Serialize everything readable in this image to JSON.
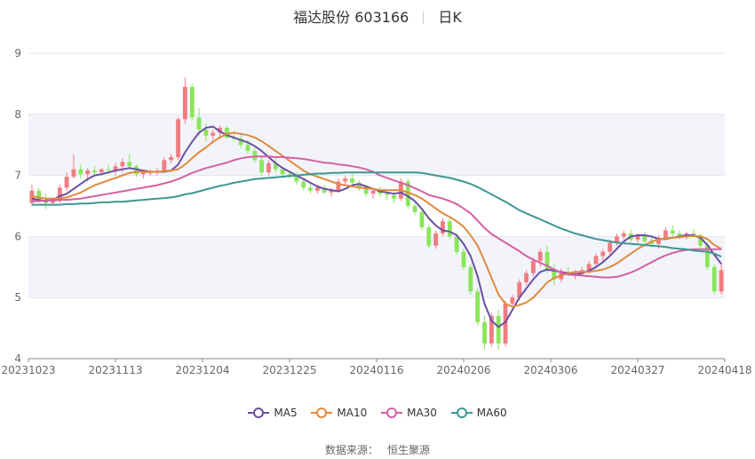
{
  "chart_data": {
    "type": "candlestick",
    "title": "福达股份 603166",
    "period": "日K",
    "ylim": [
      4,
      9
    ],
    "yticks": [
      4,
      5,
      6,
      7,
      8,
      9
    ],
    "x_tick_labels": [
      "20231023",
      "20231113",
      "20231204",
      "20231225",
      "20240116",
      "20240206",
      "20240306",
      "20240327",
      "20240418"
    ],
    "grid": true,
    "legend_position": "bottom",
    "colors": {
      "up": "#f07c82",
      "down": "#8ae65a",
      "MA5": "#6a4fa3",
      "MA10": "#e08a3c",
      "MA30": "#d65fa6",
      "MA60": "#3e9695"
    },
    "ohlc": [
      [
        6.55,
        6.85,
        6.5,
        6.75
      ],
      [
        6.75,
        6.8,
        6.55,
        6.6
      ],
      [
        6.6,
        6.7,
        6.45,
        6.55
      ],
      [
        6.55,
        6.6,
        6.5,
        6.58
      ],
      [
        6.58,
        6.85,
        6.55,
        6.8
      ],
      [
        6.8,
        7.05,
        6.75,
        6.98
      ],
      [
        6.98,
        7.35,
        6.95,
        7.1
      ],
      [
        7.1,
        7.18,
        6.95,
        7.02
      ],
      [
        7.02,
        7.12,
        6.9,
        7.08
      ],
      [
        7.08,
        7.15,
        7.0,
        7.05
      ],
      [
        7.05,
        7.12,
        7.0,
        7.1
      ],
      [
        7.1,
        7.18,
        7.02,
        7.08
      ],
      [
        7.08,
        7.2,
        7.0,
        7.15
      ],
      [
        7.15,
        7.28,
        7.05,
        7.22
      ],
      [
        7.22,
        7.35,
        7.1,
        7.15
      ],
      [
        7.15,
        7.18,
        6.98,
        7.02
      ],
      [
        7.02,
        7.08,
        6.95,
        7.05
      ],
      [
        7.05,
        7.1,
        7.0,
        7.05
      ],
      [
        7.05,
        7.12,
        7.0,
        7.08
      ],
      [
        7.08,
        7.3,
        7.05,
        7.25
      ],
      [
        7.25,
        7.35,
        7.2,
        7.3
      ],
      [
        7.3,
        7.95,
        7.25,
        7.92
      ],
      [
        7.92,
        8.6,
        7.85,
        8.45
      ],
      [
        8.45,
        8.5,
        7.9,
        7.95
      ],
      [
        7.95,
        8.1,
        7.65,
        7.75
      ],
      [
        7.75,
        7.85,
        7.55,
        7.65
      ],
      [
        7.65,
        7.75,
        7.55,
        7.7
      ],
      [
        7.7,
        7.82,
        7.6,
        7.78
      ],
      [
        7.78,
        7.8,
        7.6,
        7.62
      ],
      [
        7.62,
        7.7,
        7.55,
        7.6
      ],
      [
        7.6,
        7.68,
        7.45,
        7.5
      ],
      [
        7.5,
        7.58,
        7.35,
        7.4
      ],
      [
        7.4,
        7.45,
        7.2,
        7.25
      ],
      [
        7.25,
        7.3,
        7.0,
        7.05
      ],
      [
        7.05,
        7.25,
        7.0,
        7.2
      ],
      [
        7.2,
        7.28,
        7.05,
        7.1
      ],
      [
        7.1,
        7.15,
        7.0,
        7.02
      ],
      [
        7.02,
        7.08,
        6.95,
        7.0
      ],
      [
        7.0,
        7.05,
        6.85,
        6.9
      ],
      [
        6.9,
        6.95,
        6.75,
        6.8
      ],
      [
        6.8,
        6.88,
        6.7,
        6.75
      ],
      [
        6.75,
        6.85,
        6.7,
        6.8
      ],
      [
        6.8,
        6.85,
        6.7,
        6.72
      ],
      [
        6.72,
        6.8,
        6.65,
        6.75
      ],
      [
        6.75,
        6.95,
        6.72,
        6.9
      ],
      [
        6.9,
        7.0,
        6.85,
        6.95
      ],
      [
        6.95,
        7.02,
        6.85,
        6.88
      ],
      [
        6.88,
        6.92,
        6.75,
        6.8
      ],
      [
        6.8,
        6.85,
        6.65,
        6.7
      ],
      [
        6.7,
        6.78,
        6.62,
        6.75
      ],
      [
        6.75,
        6.82,
        6.65,
        6.7
      ],
      [
        6.7,
        6.75,
        6.6,
        6.68
      ],
      [
        6.68,
        6.72,
        6.55,
        6.62
      ],
      [
        6.62,
        6.95,
        6.58,
        6.9
      ],
      [
        6.9,
        6.95,
        6.45,
        6.5
      ],
      [
        6.5,
        6.55,
        6.35,
        6.4
      ],
      [
        6.4,
        6.45,
        6.1,
        6.15
      ],
      [
        6.15,
        6.2,
        5.8,
        5.85
      ],
      [
        5.85,
        6.1,
        5.8,
        6.05
      ],
      [
        6.05,
        6.3,
        6.0,
        6.25
      ],
      [
        6.25,
        6.3,
        5.95,
        6.0
      ],
      [
        6.0,
        6.05,
        5.7,
        5.75
      ],
      [
        5.75,
        5.8,
        5.45,
        5.5
      ],
      [
        5.5,
        5.55,
        5.05,
        5.1
      ],
      [
        5.1,
        5.15,
        4.55,
        4.6
      ],
      [
        4.6,
        4.7,
        4.15,
        4.25
      ],
      [
        4.25,
        4.75,
        4.2,
        4.7
      ],
      [
        4.7,
        4.8,
        4.15,
        4.25
      ],
      [
        4.25,
        4.95,
        4.2,
        4.9
      ],
      [
        4.9,
        5.05,
        4.85,
        5.0
      ],
      [
        5.0,
        5.3,
        4.95,
        5.25
      ],
      [
        5.25,
        5.45,
        5.2,
        5.4
      ],
      [
        5.4,
        5.65,
        5.35,
        5.6
      ],
      [
        5.6,
        5.8,
        5.5,
        5.75
      ],
      [
        5.75,
        5.85,
        5.4,
        5.45
      ],
      [
        5.45,
        5.55,
        5.2,
        5.3
      ],
      [
        5.3,
        5.48,
        5.25,
        5.42
      ],
      [
        5.42,
        5.5,
        5.35,
        5.38
      ],
      [
        5.38,
        5.45,
        5.3,
        5.4
      ],
      [
        5.4,
        5.5,
        5.35,
        5.45
      ],
      [
        5.45,
        5.6,
        5.4,
        5.55
      ],
      [
        5.55,
        5.72,
        5.5,
        5.68
      ],
      [
        5.68,
        5.8,
        5.6,
        5.75
      ],
      [
        5.75,
        5.95,
        5.7,
        5.9
      ],
      [
        5.9,
        6.05,
        5.85,
        6.0
      ],
      [
        6.0,
        6.1,
        5.95,
        6.05
      ],
      [
        6.05,
        6.12,
        5.9,
        5.95
      ],
      [
        5.95,
        6.05,
        5.9,
        6.02
      ],
      [
        6.02,
        6.08,
        5.88,
        5.92
      ],
      [
        5.92,
        5.98,
        5.82,
        5.88
      ],
      [
        5.88,
        6.02,
        5.8,
        5.98
      ],
      [
        5.98,
        6.15,
        5.95,
        6.1
      ],
      [
        6.1,
        6.18,
        6.0,
        6.05
      ],
      [
        6.05,
        6.1,
        5.95,
        6.0
      ],
      [
        6.0,
        6.08,
        5.95,
        6.05
      ],
      [
        6.05,
        6.12,
        5.98,
        6.02
      ],
      [
        6.02,
        6.05,
        5.8,
        5.85
      ],
      [
        5.85,
        5.9,
        5.45,
        5.5
      ],
      [
        5.5,
        5.55,
        5.05,
        5.1
      ],
      [
        5.1,
        5.55,
        5.05,
        5.45
      ]
    ],
    "series": [
      {
        "name": "MA5",
        "values": [
          6.62,
          6.6,
          6.58,
          6.6,
          6.66,
          6.7,
          6.78,
          6.86,
          6.94,
          7.0,
          7.02,
          7.05,
          7.08,
          7.1,
          7.12,
          7.1,
          7.08,
          7.06,
          7.06,
          7.06,
          7.08,
          7.18,
          7.38,
          7.55,
          7.7,
          7.78,
          7.8,
          7.72,
          7.66,
          7.62,
          7.58,
          7.54,
          7.48,
          7.4,
          7.3,
          7.2,
          7.12,
          7.06,
          7.0,
          6.94,
          6.88,
          6.82,
          6.78,
          6.76,
          6.74,
          6.78,
          6.84,
          6.86,
          6.82,
          6.78,
          6.74,
          6.72,
          6.7,
          6.72,
          6.66,
          6.58,
          6.45,
          6.3,
          6.18,
          6.1,
          6.08,
          6.02,
          5.88,
          5.68,
          5.35,
          4.9,
          4.62,
          4.52,
          4.6,
          4.8,
          5.0,
          5.15,
          5.3,
          5.42,
          5.46,
          5.44,
          5.42,
          5.4,
          5.38,
          5.4,
          5.44,
          5.5,
          5.58,
          5.68,
          5.8,
          5.92,
          6.0,
          6.02,
          6.02,
          6.0,
          5.96,
          5.96,
          5.98,
          6.0,
          6.02,
          6.02,
          5.98,
          5.86,
          5.7,
          5.55
        ]
      },
      {
        "name": "MA10",
        "values": [
          6.66,
          6.64,
          6.62,
          6.62,
          6.63,
          6.64,
          6.68,
          6.72,
          6.78,
          6.84,
          6.88,
          6.92,
          6.96,
          7.0,
          7.04,
          7.06,
          7.06,
          7.06,
          7.06,
          7.07,
          7.08,
          7.1,
          7.18,
          7.28,
          7.38,
          7.46,
          7.55,
          7.62,
          7.68,
          7.7,
          7.68,
          7.66,
          7.62,
          7.56,
          7.48,
          7.4,
          7.32,
          7.24,
          7.16,
          7.08,
          7.02,
          6.98,
          6.94,
          6.9,
          6.86,
          6.84,
          6.82,
          6.8,
          6.79,
          6.78,
          6.76,
          6.76,
          6.76,
          6.76,
          6.72,
          6.68,
          6.62,
          6.54,
          6.46,
          6.38,
          6.32,
          6.25,
          6.16,
          6.02,
          5.85,
          5.6,
          5.32,
          5.05,
          4.9,
          4.85,
          4.88,
          4.92,
          5.0,
          5.12,
          5.25,
          5.32,
          5.36,
          5.4,
          5.42,
          5.42,
          5.42,
          5.44,
          5.46,
          5.5,
          5.56,
          5.64,
          5.72,
          5.8,
          5.86,
          5.92,
          5.95,
          5.97,
          5.98,
          5.99,
          6.0,
          6.01,
          6.0,
          5.96,
          5.86,
          5.8
        ]
      },
      {
        "name": "MA30",
        "values": [
          6.58,
          6.58,
          6.59,
          6.59,
          6.6,
          6.6,
          6.61,
          6.62,
          6.64,
          6.66,
          6.68,
          6.7,
          6.72,
          6.74,
          6.76,
          6.78,
          6.8,
          6.82,
          6.84,
          6.87,
          6.9,
          6.94,
          6.99,
          7.04,
          7.08,
          7.12,
          7.15,
          7.18,
          7.21,
          7.25,
          7.28,
          7.3,
          7.31,
          7.31,
          7.31,
          7.3,
          7.3,
          7.29,
          7.28,
          7.27,
          7.25,
          7.23,
          7.21,
          7.2,
          7.18,
          7.17,
          7.15,
          7.13,
          7.1,
          7.06,
          7.0,
          6.96,
          6.92,
          6.88,
          6.84,
          6.79,
          6.74,
          6.68,
          6.65,
          6.62,
          6.58,
          6.53,
          6.46,
          6.38,
          6.26,
          6.14,
          6.04,
          5.97,
          5.9,
          5.83,
          5.76,
          5.68,
          5.62,
          5.57,
          5.52,
          5.46,
          5.41,
          5.38,
          5.37,
          5.36,
          5.35,
          5.34,
          5.33,
          5.33,
          5.34,
          5.37,
          5.41,
          5.46,
          5.52,
          5.58,
          5.64,
          5.69,
          5.73,
          5.76,
          5.78,
          5.79,
          5.79,
          5.79,
          5.79,
          5.79
        ]
      },
      {
        "name": "MA60",
        "values": [
          6.52,
          6.52,
          6.52,
          6.52,
          6.52,
          6.53,
          6.53,
          6.54,
          6.54,
          6.55,
          6.56,
          6.56,
          6.57,
          6.57,
          6.58,
          6.59,
          6.6,
          6.61,
          6.62,
          6.63,
          6.64,
          6.66,
          6.69,
          6.71,
          6.74,
          6.77,
          6.8,
          6.83,
          6.85,
          6.88,
          6.9,
          6.92,
          6.94,
          6.95,
          6.96,
          6.97,
          6.98,
          6.99,
          7.0,
          7.01,
          7.02,
          7.03,
          7.03,
          7.04,
          7.04,
          7.05,
          7.05,
          7.05,
          7.05,
          7.05,
          7.05,
          7.05,
          7.05,
          7.05,
          7.05,
          7.05,
          7.04,
          7.02,
          7.0,
          6.98,
          6.96,
          6.93,
          6.9,
          6.86,
          6.81,
          6.75,
          6.69,
          6.63,
          6.57,
          6.5,
          6.43,
          6.38,
          6.33,
          6.28,
          6.23,
          6.18,
          6.13,
          6.09,
          6.05,
          6.02,
          5.99,
          5.96,
          5.94,
          5.92,
          5.9,
          5.89,
          5.88,
          5.87,
          5.86,
          5.85,
          5.84,
          5.83,
          5.81,
          5.8,
          5.79,
          5.77,
          5.76,
          5.75,
          5.72,
          5.67
        ]
      }
    ]
  },
  "header": {
    "title": "福达股份 603166",
    "period": "日K"
  },
  "legend": [
    "MA5",
    "MA10",
    "MA30",
    "MA60"
  ],
  "source": {
    "label": "数据来源：",
    "name": "恒生聚源"
  }
}
